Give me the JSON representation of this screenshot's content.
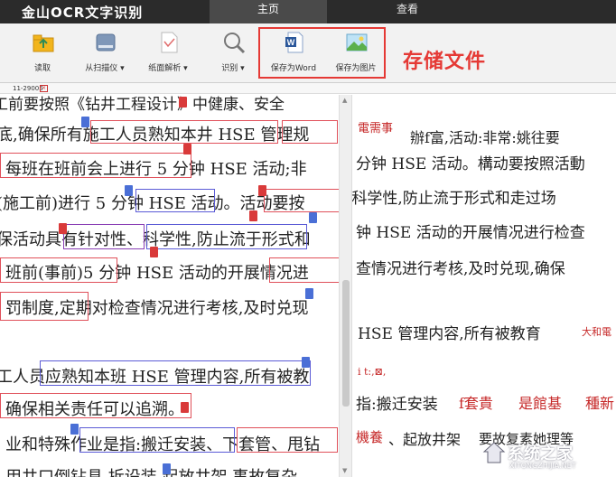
{
  "app": {
    "title": "金山OCR文字识别"
  },
  "tabs": [
    {
      "label": "主页"
    },
    {
      "label": "查看"
    }
  ],
  "toolbar": {
    "read": "读取",
    "scan": "从扫描仪 ▾",
    "parse": "纸面解析 ▾",
    "recognize": "识别 ▾",
    "save_word": "保存为Word",
    "save_image": "保存为图片"
  },
  "annotation": "存储文件",
  "file_tab": {
    "name": "11-29005"
  },
  "left_lines": [
    "工前要按照《钻井工程设计》中健康、安全",
    "底,确保所有施工人员熟知本井 HSE 管理规",
    "每班在班前会上进行 5 分钟 HSE 活动;非",
    "(施工前)进行 5 分钟 HSE 活动。活动要按",
    "保活动具有针对性、科学性,防止流于形式和",
    "班前(事前)5 分钟 HSE 活动的开展情况进",
    "罚制度,定期对检查情况进行考核,及时兑现",
    "工人员应熟知本班 HSE 管理内容,所有被教",
    "确保相关责任可以追溯。",
    "业和特殊作业是指:搬迁安装、下套管、甩钻",
    "用井口倒钻具 拆设装 起放井架 事故复杂"
  ],
  "right_lines": [
    "電需事",
    "辦f富,活动:非常:姚往要",
    "分钟 HSE 活动。構动要按照活動",
    "·科学性,防止流于形式和走过场",
    "钟 HSE 活动的开展情况进行检查",
    "查情况进行考核,及时兑现,确保",
    "HSE 管理内容,所有被教育",
    "大和電",
    "i t:,⊠,",
    "指:搬迁安装",
    "f套貴",
    "是館基",
    "種新",
    "機養",
    "、起放井架",
    "要故复素她理等"
  ],
  "watermark": {
    "text": "系统之家",
    "url": "XITONGZHIJIA.NET"
  }
}
